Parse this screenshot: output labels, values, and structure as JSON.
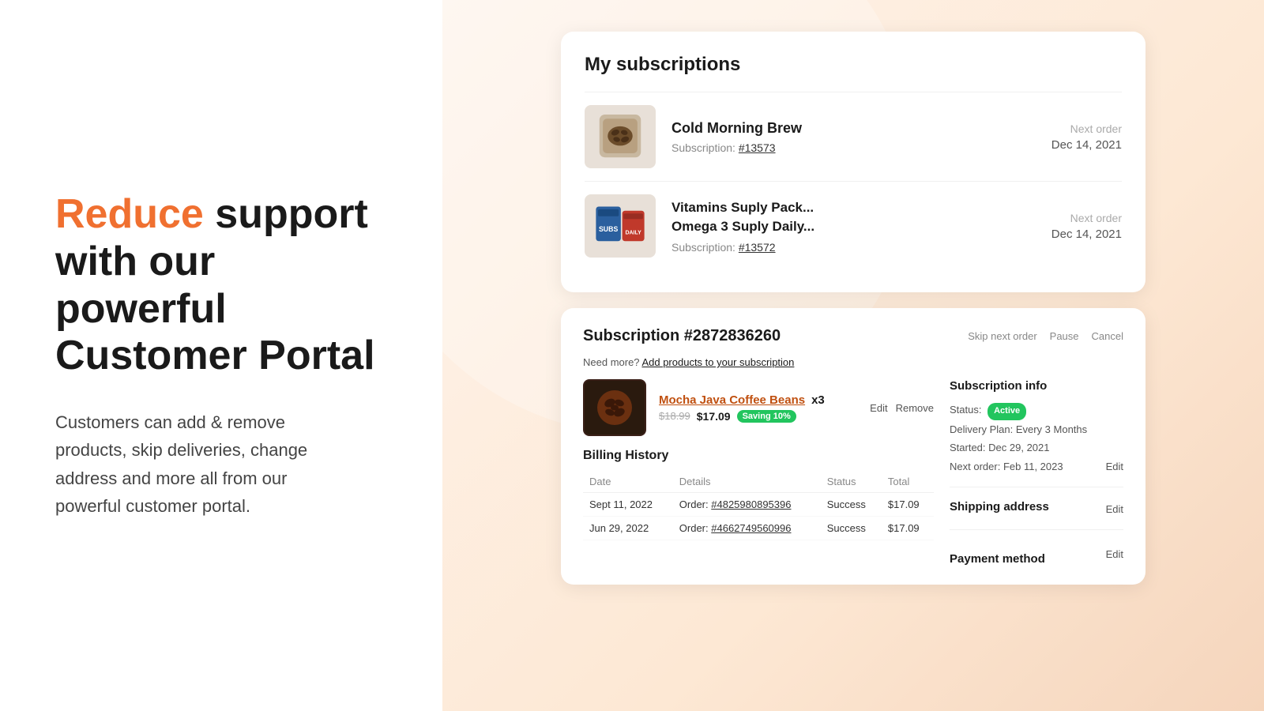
{
  "left": {
    "headline_highlight": "Reduce",
    "headline_rest": " support\nwith our powerful\nCustomer Portal",
    "body": "Customers can add & remove\nproducts, skip deliveries, change\naddress and more all from our\npowerful customer portal."
  },
  "subscriptions_card": {
    "title": "My subscriptions",
    "items": [
      {
        "name": "Cold Morning Brew",
        "subscription_label": "Subscription: ",
        "subscription_id": "#13573",
        "next_order_label": "Next order",
        "next_order_date": "Dec 14, 2021"
      },
      {
        "name_line1": "Vitamins Suply Pack...",
        "name_line2": "Omega 3 Suply Daily...",
        "subscription_label": "Subscription: ",
        "subscription_id": "#13572",
        "next_order_label": "Next order",
        "next_order_date": "Dec 14, 2021"
      }
    ]
  },
  "detail_card": {
    "title": "Subscription #2872836260",
    "actions": {
      "skip": "Skip next order",
      "pause": "Pause",
      "cancel": "Cancel"
    },
    "add_products_text": "Need more?",
    "add_products_link": "Add products to your subscription",
    "product": {
      "name": "Mocha Java Coffee Beans",
      "qty": "x3",
      "price_old": "$18.99",
      "price_new": "$17.09",
      "saving": "Saving 10%",
      "edit": "Edit",
      "remove": "Remove"
    },
    "billing": {
      "title": "Billing History",
      "columns": [
        "Date",
        "Details",
        "Status",
        "Total"
      ],
      "rows": [
        {
          "date": "Sept 11, 2022",
          "details_label": "Order: ",
          "details_id": "#4825980895396",
          "status": "Success",
          "total": "$17.09"
        },
        {
          "date": "Jun 29, 2022",
          "details_label": "Order: ",
          "details_id": "#4662749560996",
          "status": "Success",
          "total": "$17.09"
        }
      ]
    },
    "sub_info": {
      "title": "Subscription info",
      "status_label": "Status:",
      "status_value": "Active",
      "delivery_label": "Delivery Plan:",
      "delivery_value": "Every 3 Months",
      "started_label": "Started:",
      "started_value": "Dec 29, 2021",
      "next_order_label": "Next order:",
      "next_order_value": "Feb 11, 2023",
      "edit": "Edit"
    },
    "shipping": {
      "title": "Shipping address",
      "edit": "Edit"
    },
    "payment": {
      "title": "Payment method",
      "edit": "Edit"
    }
  }
}
